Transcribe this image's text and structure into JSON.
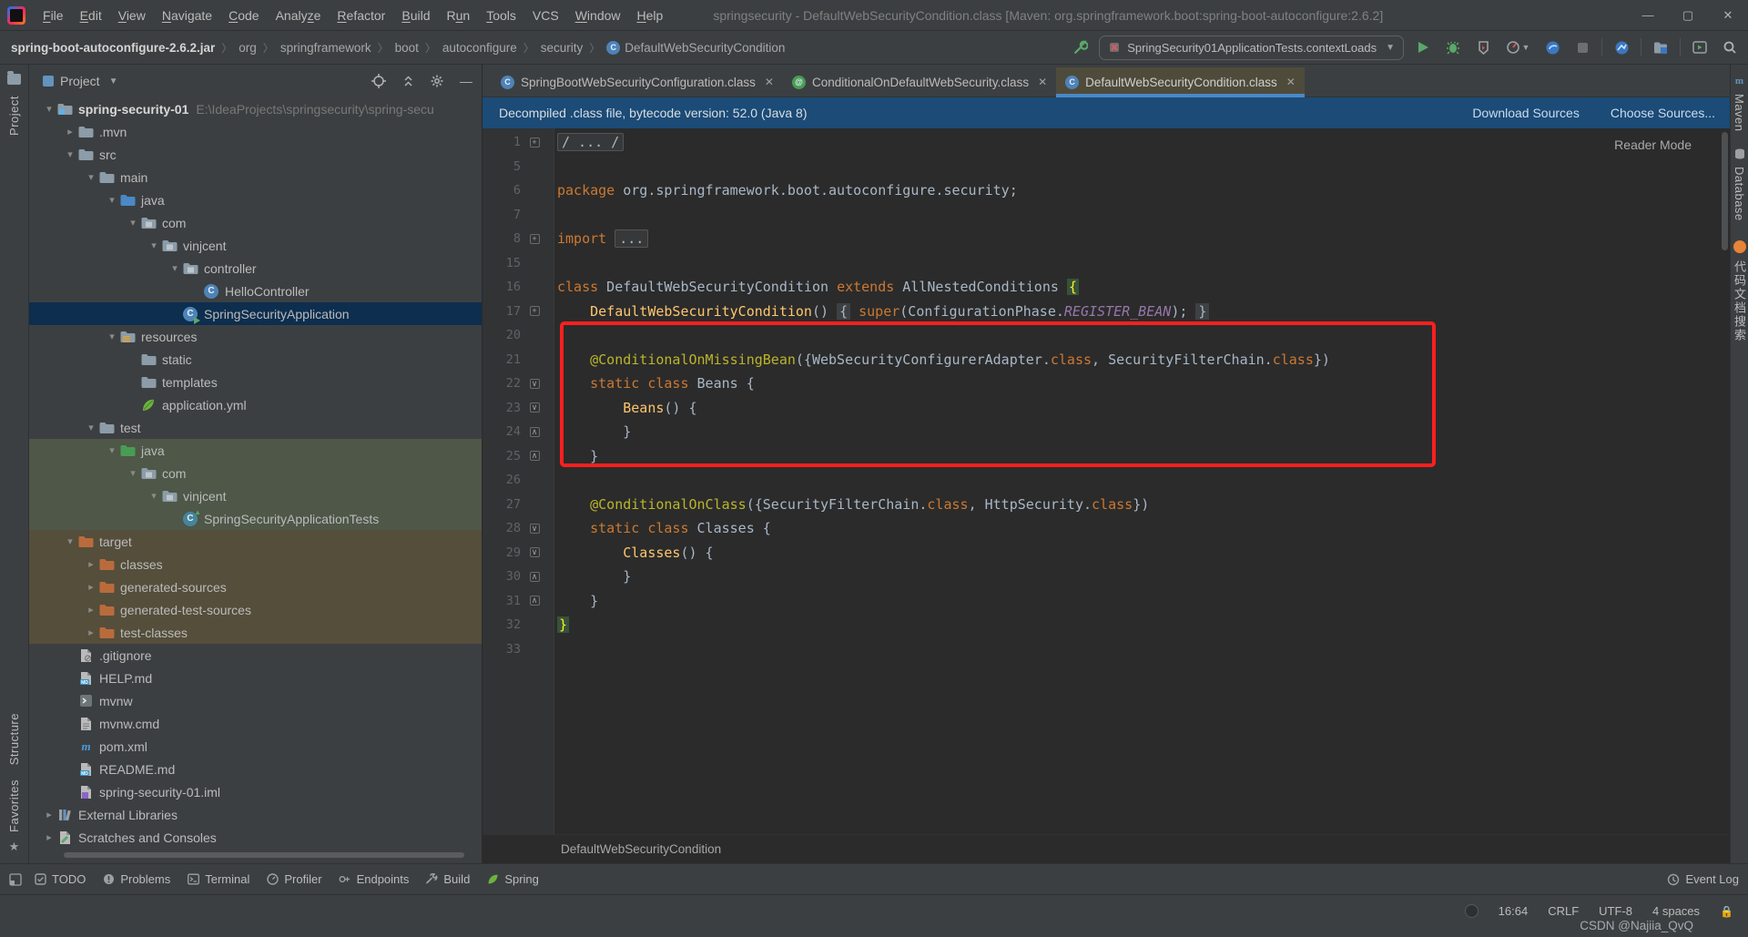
{
  "window": {
    "title": "springsecurity - DefaultWebSecurityCondition.class [Maven: org.springframework.boot:spring-boot-autoconfigure:2.6.2]",
    "controls": {
      "minimize": "—",
      "maximize": "▢",
      "close": "✕"
    }
  },
  "menu": [
    "File",
    "Edit",
    "View",
    "Navigate",
    "Code",
    "Analyze",
    "Refactor",
    "Build",
    "Run",
    "Tools",
    "VCS",
    "Window",
    "Help"
  ],
  "menu_underline": [
    0,
    0,
    0,
    0,
    0,
    5,
    0,
    0,
    1,
    0,
    -1,
    0,
    0
  ],
  "breadcrumbs": [
    "spring-boot-autoconfigure-2.6.2.jar",
    "org",
    "springframework",
    "boot",
    "autoconfigure",
    "security",
    "DefaultWebSecurityCondition"
  ],
  "run_widget": {
    "config": "SpringSecurity01ApplicationTests.contextLoads"
  },
  "left_strip": {
    "top": "Project",
    "bottom": [
      "Structure",
      "Favorites"
    ]
  },
  "right_strip": {
    "items": [
      "Maven",
      "Database",
      "代码文档搜索"
    ]
  },
  "project_panel": {
    "header": "Project",
    "tree": [
      {
        "level": 0,
        "chevron": "open",
        "icon": "folder-project",
        "label": "spring-security-01",
        "extra": "E:\\IdeaProjects\\springsecurity\\spring-secu",
        "bold": true
      },
      {
        "level": 1,
        "chevron": "closed",
        "icon": "folder",
        "label": ".mvn"
      },
      {
        "level": 1,
        "chevron": "open",
        "icon": "folder",
        "label": "src"
      },
      {
        "level": 2,
        "chevron": "open",
        "icon": "folder",
        "label": "main"
      },
      {
        "level": 3,
        "chevron": "open",
        "icon": "folder-src",
        "label": "java"
      },
      {
        "level": 4,
        "chevron": "open",
        "icon": "package",
        "label": "com"
      },
      {
        "level": 5,
        "chevron": "open",
        "icon": "package",
        "label": "vinjcent"
      },
      {
        "level": 6,
        "chevron": "open",
        "icon": "package",
        "label": "controller"
      },
      {
        "level": 7,
        "chevron": "none",
        "icon": "class",
        "label": "HelloController"
      },
      {
        "level": 6,
        "chevron": "none",
        "icon": "class-run",
        "label": "SpringSecurityApplication",
        "selected": true
      },
      {
        "level": 3,
        "chevron": "open",
        "icon": "folder-res",
        "label": "resources"
      },
      {
        "level": 4,
        "chevron": "none",
        "icon": "folder",
        "label": "static"
      },
      {
        "level": 4,
        "chevron": "none",
        "icon": "folder",
        "label": "templates"
      },
      {
        "level": 4,
        "chevron": "none",
        "icon": "spring-leaf",
        "label": "application.yml"
      },
      {
        "level": 2,
        "chevron": "open",
        "icon": "folder",
        "label": "test"
      },
      {
        "level": 3,
        "chevron": "open",
        "icon": "folder-test",
        "label": "java",
        "hl": "green"
      },
      {
        "level": 4,
        "chevron": "open",
        "icon": "package",
        "label": "com",
        "hl": "green"
      },
      {
        "level": 5,
        "chevron": "open",
        "icon": "package",
        "label": "vinjcent",
        "hl": "green"
      },
      {
        "level": 6,
        "chevron": "none",
        "icon": "class-test",
        "label": "SpringSecurityApplicationTests",
        "hl": "green"
      },
      {
        "level": 1,
        "chevron": "open",
        "icon": "folder-excl",
        "label": "target",
        "hl": "brown"
      },
      {
        "level": 2,
        "chevron": "closed",
        "icon": "folder-excl",
        "label": "classes",
        "hl": "brown"
      },
      {
        "level": 2,
        "chevron": "closed",
        "icon": "folder-excl",
        "label": "generated-sources",
        "hl": "brown"
      },
      {
        "level": 2,
        "chevron": "closed",
        "icon": "folder-excl",
        "label": "generated-test-sources",
        "hl": "brown"
      },
      {
        "level": 2,
        "chevron": "closed",
        "icon": "folder-excl",
        "label": "test-classes",
        "hl": "brown"
      },
      {
        "level": 1,
        "chevron": "none",
        "icon": "git-file",
        "label": ".gitignore"
      },
      {
        "level": 1,
        "chevron": "none",
        "icon": "md-file",
        "label": "HELP.md"
      },
      {
        "level": 1,
        "chevron": "none",
        "icon": "shell-file",
        "label": "mvnw"
      },
      {
        "level": 1,
        "chevron": "none",
        "icon": "text-file",
        "label": "mvnw.cmd"
      },
      {
        "level": 1,
        "chevron": "none",
        "icon": "maven-file",
        "label": "pom.xml"
      },
      {
        "level": 1,
        "chevron": "none",
        "icon": "md-file",
        "label": "README.md"
      },
      {
        "level": 1,
        "chevron": "none",
        "icon": "iml-file",
        "label": "spring-security-01.iml"
      },
      {
        "level": 0,
        "chevron": "closed",
        "icon": "library",
        "label": "External Libraries"
      },
      {
        "level": 0,
        "chevron": "closed",
        "icon": "scratch",
        "label": "Scratches and Consoles"
      }
    ]
  },
  "tabs": [
    {
      "label": "SpringBootWebSecurityConfiguration.class",
      "icon": "class-c",
      "close": "✕",
      "active": false
    },
    {
      "label": "ConditionalOnDefaultWebSecurity.class",
      "icon": "class-at",
      "close": "✕",
      "active": false
    },
    {
      "label": "DefaultWebSecurityCondition.class",
      "icon": "class-c",
      "close": "✕",
      "active": true
    }
  ],
  "banner": {
    "text": "Decompiled .class file, bytecode version: 52.0 (Java 8)",
    "links": [
      "Download Sources",
      "Choose Sources..."
    ]
  },
  "editor": {
    "reader_mode": "Reader Mode",
    "breadcrumb": "DefaultWebSecurityCondition",
    "lines": [
      {
        "num": 1,
        "fold": "plus",
        "tokens": [
          [
            "fold",
            "/ ... /"
          ]
        ]
      },
      {
        "num": 5,
        "tokens": []
      },
      {
        "num": 6,
        "tokens": [
          [
            "kw",
            "package"
          ],
          [
            "tx",
            " org.springframework.boot.autoconfigure.security;"
          ]
        ]
      },
      {
        "num": 7,
        "tokens": []
      },
      {
        "num": 8,
        "fold": "plus",
        "tokens": [
          [
            "kw",
            "import"
          ],
          [
            "tx",
            " "
          ],
          [
            "fold",
            "..."
          ]
        ]
      },
      {
        "num": 15,
        "tokens": []
      },
      {
        "num": 16,
        "tokens": [
          [
            "kw",
            "class"
          ],
          [
            "tx",
            " DefaultWebSecurityCondition "
          ],
          [
            "kw",
            "extends"
          ],
          [
            "tx",
            " AllNestedConditions "
          ],
          [
            "bhl",
            "{"
          ]
        ]
      },
      {
        "num": 17,
        "fold": "plus",
        "tokens": [
          [
            "tx",
            "    "
          ],
          [
            "fn",
            "DefaultWebSecurityCondition"
          ],
          [
            "tx",
            "() "
          ],
          [
            "gb",
            "{"
          ],
          [
            "tx",
            " "
          ],
          [
            "kw",
            "super"
          ],
          [
            "tx",
            "(ConfigurationPhase."
          ],
          [
            "cst",
            "REGISTER_BEAN"
          ],
          [
            "tx",
            "); "
          ],
          [
            "gb",
            "}"
          ]
        ]
      },
      {
        "num": 20,
        "tokens": []
      },
      {
        "num": 21,
        "tokens": [
          [
            "tx",
            "    "
          ],
          [
            "ann",
            "@ConditionalOnMissingBean"
          ],
          [
            "tx",
            "({WebSecurityConfigurerAdapter."
          ],
          [
            "kw",
            "class"
          ],
          [
            "tx",
            ", SecurityFilterChain."
          ],
          [
            "kw",
            "class"
          ],
          [
            "tx",
            "})"
          ]
        ]
      },
      {
        "num": 22,
        "fold": "down",
        "tokens": [
          [
            "tx",
            "    "
          ],
          [
            "kw",
            "static class"
          ],
          [
            "tx",
            " Beans {"
          ]
        ]
      },
      {
        "num": 23,
        "fold": "down",
        "tokens": [
          [
            "tx",
            "        "
          ],
          [
            "fn",
            "Beans"
          ],
          [
            "tx",
            "() {"
          ]
        ]
      },
      {
        "num": 24,
        "fold": "up",
        "tokens": [
          [
            "tx",
            "        }"
          ]
        ]
      },
      {
        "num": 25,
        "fold": "up",
        "tokens": [
          [
            "tx",
            "    }"
          ]
        ]
      },
      {
        "num": 26,
        "tokens": []
      },
      {
        "num": 27,
        "tokens": [
          [
            "tx",
            "    "
          ],
          [
            "ann",
            "@ConditionalOnClass"
          ],
          [
            "tx",
            "({SecurityFilterChain."
          ],
          [
            "kw",
            "class"
          ],
          [
            "tx",
            ", HttpSecurity."
          ],
          [
            "kw",
            "class"
          ],
          [
            "tx",
            "})"
          ]
        ]
      },
      {
        "num": 28,
        "fold": "down",
        "tokens": [
          [
            "tx",
            "    "
          ],
          [
            "kw",
            "static class"
          ],
          [
            "tx",
            " Classes {"
          ]
        ]
      },
      {
        "num": 29,
        "fold": "down",
        "tokens": [
          [
            "tx",
            "        "
          ],
          [
            "fn",
            "Classes"
          ],
          [
            "tx",
            "() {"
          ]
        ]
      },
      {
        "num": 30,
        "fold": "up",
        "tokens": [
          [
            "tx",
            "        }"
          ]
        ]
      },
      {
        "num": 31,
        "fold": "up",
        "tokens": [
          [
            "tx",
            "    }"
          ]
        ]
      },
      {
        "num": 32,
        "tokens": [
          [
            "bhl",
            "}"
          ]
        ]
      },
      {
        "num": 33,
        "tokens": []
      }
    ]
  },
  "bottom_toolbar": {
    "items": [
      {
        "icon": "todo",
        "label": "TODO"
      },
      {
        "icon": "problems",
        "label": "Problems"
      },
      {
        "icon": "terminal",
        "label": "Terminal"
      },
      {
        "icon": "profiler",
        "label": "Profiler"
      },
      {
        "icon": "endpoints",
        "label": "Endpoints"
      },
      {
        "icon": "build",
        "label": "Build"
      },
      {
        "icon": "spring",
        "label": "Spring"
      }
    ],
    "event_log": "Event Log"
  },
  "status_bar": {
    "position": "16:64",
    "line_ending": "CRLF",
    "encoding": "UTF-8",
    "indent": "4 spaces",
    "watermark": "CSDN @Najiia_QvQ"
  },
  "colors": {
    "accent_blue": "#4A88C7",
    "banner_bg": "#1b4b76",
    "selection_bg": "#0d2e4e",
    "annotation_box": "#FF1F1F",
    "keyword": "#CC7832",
    "annotation": "#BBB529",
    "editor_bg": "#2B2B2B"
  }
}
